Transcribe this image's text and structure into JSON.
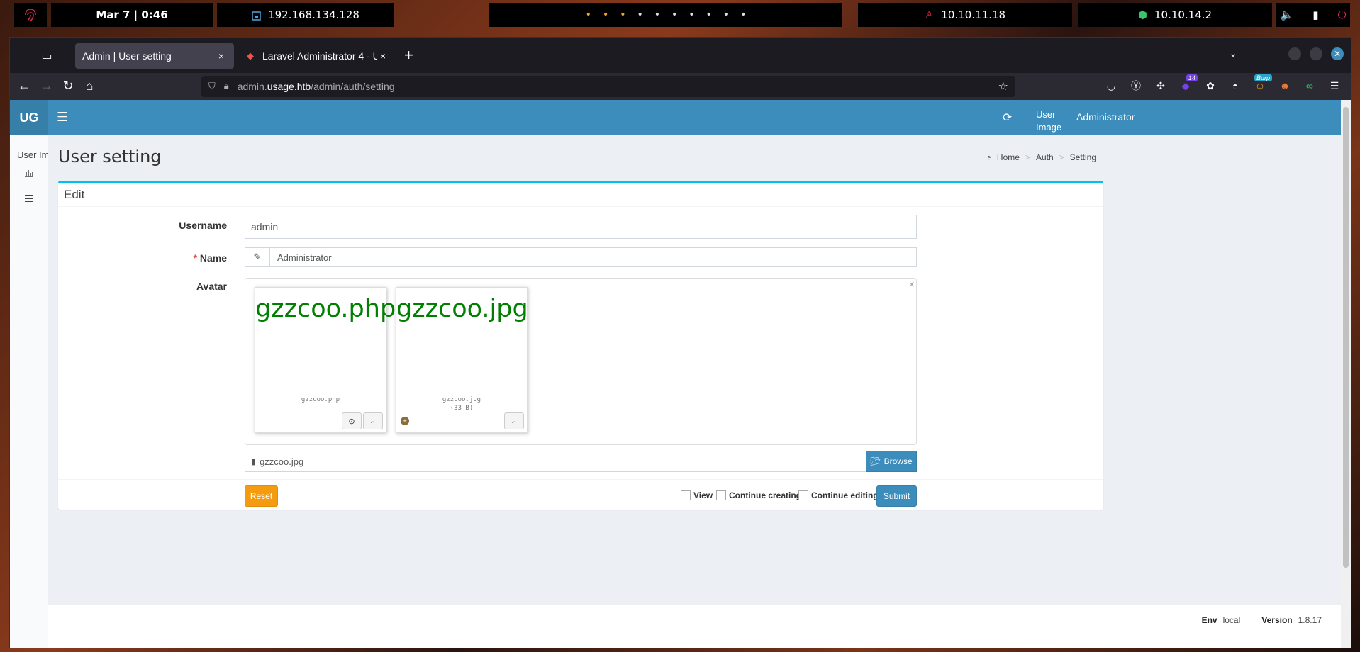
{
  "topbar": {
    "clock": "Mar 7 | 0:46",
    "local_ip": "192.168.134.128",
    "dots": [
      "orange",
      "orange",
      "orange",
      "white",
      "white",
      "white",
      "white",
      "white",
      "white",
      "white"
    ],
    "target_ip": "10.10.11.18",
    "vpn_ip": "10.10.14.2"
  },
  "browser": {
    "tabs": [
      {
        "title": "Admin | User setting",
        "close": "×"
      },
      {
        "title": "Laravel Administrator 4 - U",
        "close": "×"
      }
    ],
    "new_tab": "+",
    "url_prefix": "admin.",
    "url_host": "usage.htb",
    "url_path": "/admin/auth/setting",
    "ext_badge": "14",
    "ext_burp": "Burp"
  },
  "app": {
    "logo": "UG",
    "user_image": "User Image",
    "user_name": "Administrator",
    "sidebar_user": "User Im",
    "page_title": "User setting",
    "breadcrumb": [
      "Home",
      "Auth",
      "Setting"
    ],
    "box_title": "Edit"
  },
  "form": {
    "username_label": "Username",
    "username_value": "admin",
    "name_required": "*",
    "name_label": "Name",
    "name_value": "Administrator",
    "avatar_label": "Avatar",
    "avatar_close": "×",
    "previews": [
      {
        "big_text": "gzzcoo.php",
        "caption": "gzzcoo.php",
        "size": ""
      },
      {
        "big_text": "gzzcoo.jpg",
        "caption": "gzzcoo.jpg",
        "size": "(33 B)"
      }
    ],
    "file_value": "gzzcoo.jpg",
    "browse_label": "Browse",
    "reset_label": "Reset",
    "view_label": "View",
    "continue_creating_label": "Continue creating",
    "continue_editing_label": "Continue editing",
    "submit_label": "Submit"
  },
  "footer": {
    "env_label": "Env",
    "env_value": "local",
    "version_label": "Version",
    "version_value": "1.8.17"
  },
  "colors": {
    "header_blue": "#3c8dbc",
    "box_top": "#00c0ef",
    "reset_orange": "#f39c12",
    "preview_green": "#008000"
  }
}
